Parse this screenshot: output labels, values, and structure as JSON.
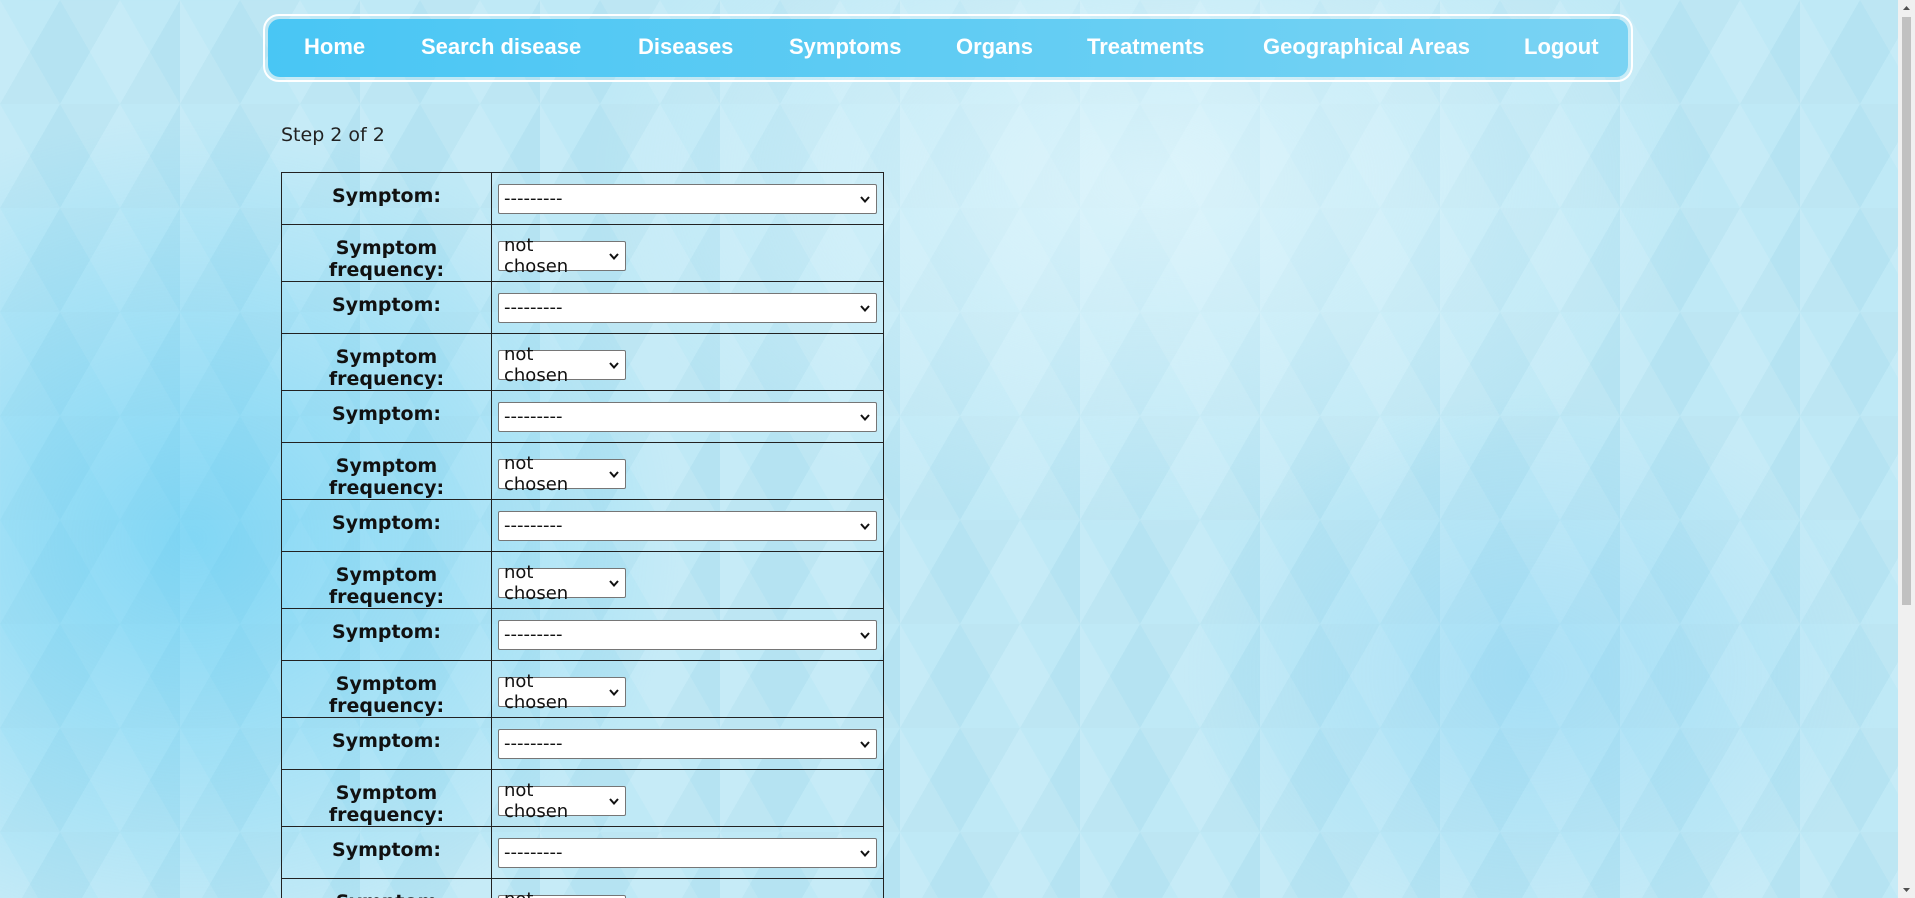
{
  "nav": {
    "items": [
      {
        "label": "Home"
      },
      {
        "label": "Search disease"
      },
      {
        "label": "Diseases"
      },
      {
        "label": "Symptoms"
      },
      {
        "label": "Organs"
      },
      {
        "label": "Treatments"
      },
      {
        "label": "Geographical Areas"
      },
      {
        "label": "Logout"
      }
    ]
  },
  "step": "Step 2 of 2",
  "form": {
    "symptom_label": "Symptom:",
    "frequency_label": "Symptom frequency:",
    "rows": [
      {
        "symptom": "---------",
        "frequency": "not chosen"
      },
      {
        "symptom": "---------",
        "frequency": "not chosen"
      },
      {
        "symptom": "---------",
        "frequency": "not chosen"
      },
      {
        "symptom": "---------",
        "frequency": "not chosen"
      },
      {
        "symptom": "---------",
        "frequency": "not chosen"
      },
      {
        "symptom": "---------",
        "frequency": "not chosen"
      },
      {
        "symptom": "---------",
        "frequency": "not chosen"
      }
    ]
  },
  "colors": {
    "nav_gradient_start": "#49c6f4",
    "nav_gradient_end": "#7ad3f3",
    "nav_text": "#ffffff"
  }
}
